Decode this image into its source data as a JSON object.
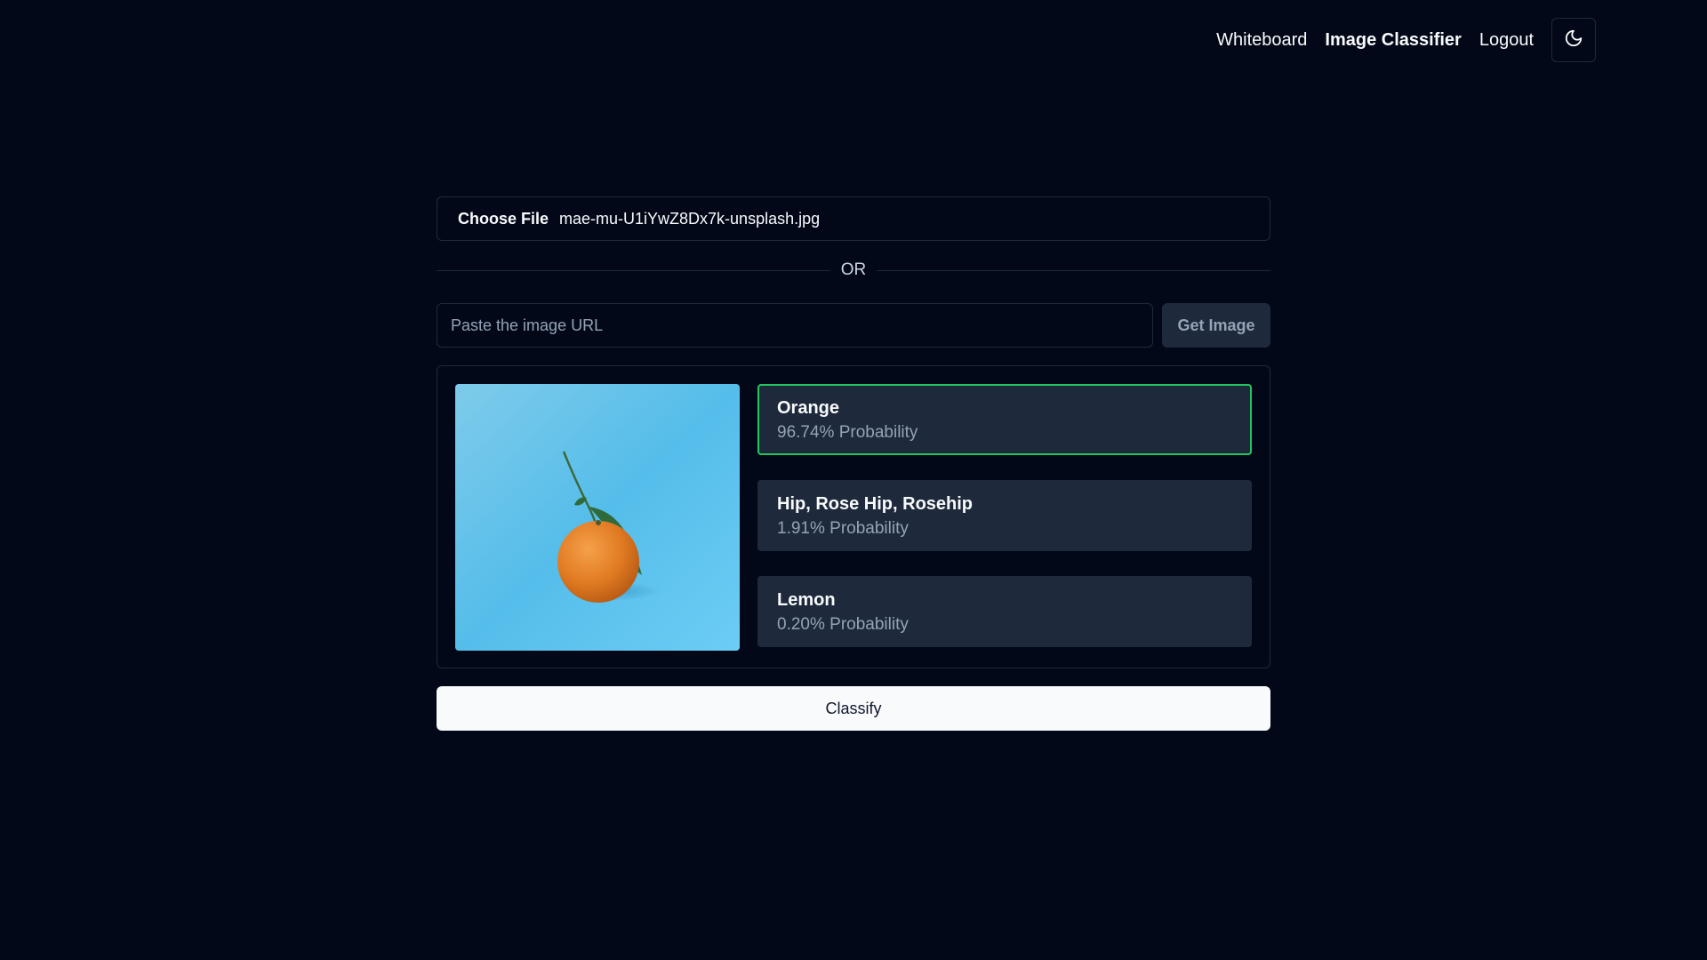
{
  "nav": {
    "links": [
      {
        "label": "Whiteboard",
        "active": false
      },
      {
        "label": "Image Classifier",
        "active": true
      },
      {
        "label": "Logout",
        "active": false
      }
    ],
    "theme_icon": "moon-icon"
  },
  "upload": {
    "choose_label": "Choose File",
    "file_name": "mae-mu-U1iYwZ8Dx7k-unsplash.jpg"
  },
  "separator": {
    "text": "OR"
  },
  "url": {
    "placeholder": "Paste the image URL",
    "value": "",
    "button_label": "Get Image"
  },
  "preview": {
    "image_subject": "orange-on-blue-background"
  },
  "predictions": [
    {
      "label": "Orange",
      "probability": "96.74% Probability",
      "top": true
    },
    {
      "label": "Hip, Rose Hip, Rosehip",
      "probability": "1.91% Probability",
      "top": false
    },
    {
      "label": "Lemon",
      "probability": "0.20% Probability",
      "top": false
    }
  ],
  "classify": {
    "label": "Classify"
  },
  "colors": {
    "background": "#020817",
    "card": "#1e293b",
    "highlight": "#22c55e"
  }
}
